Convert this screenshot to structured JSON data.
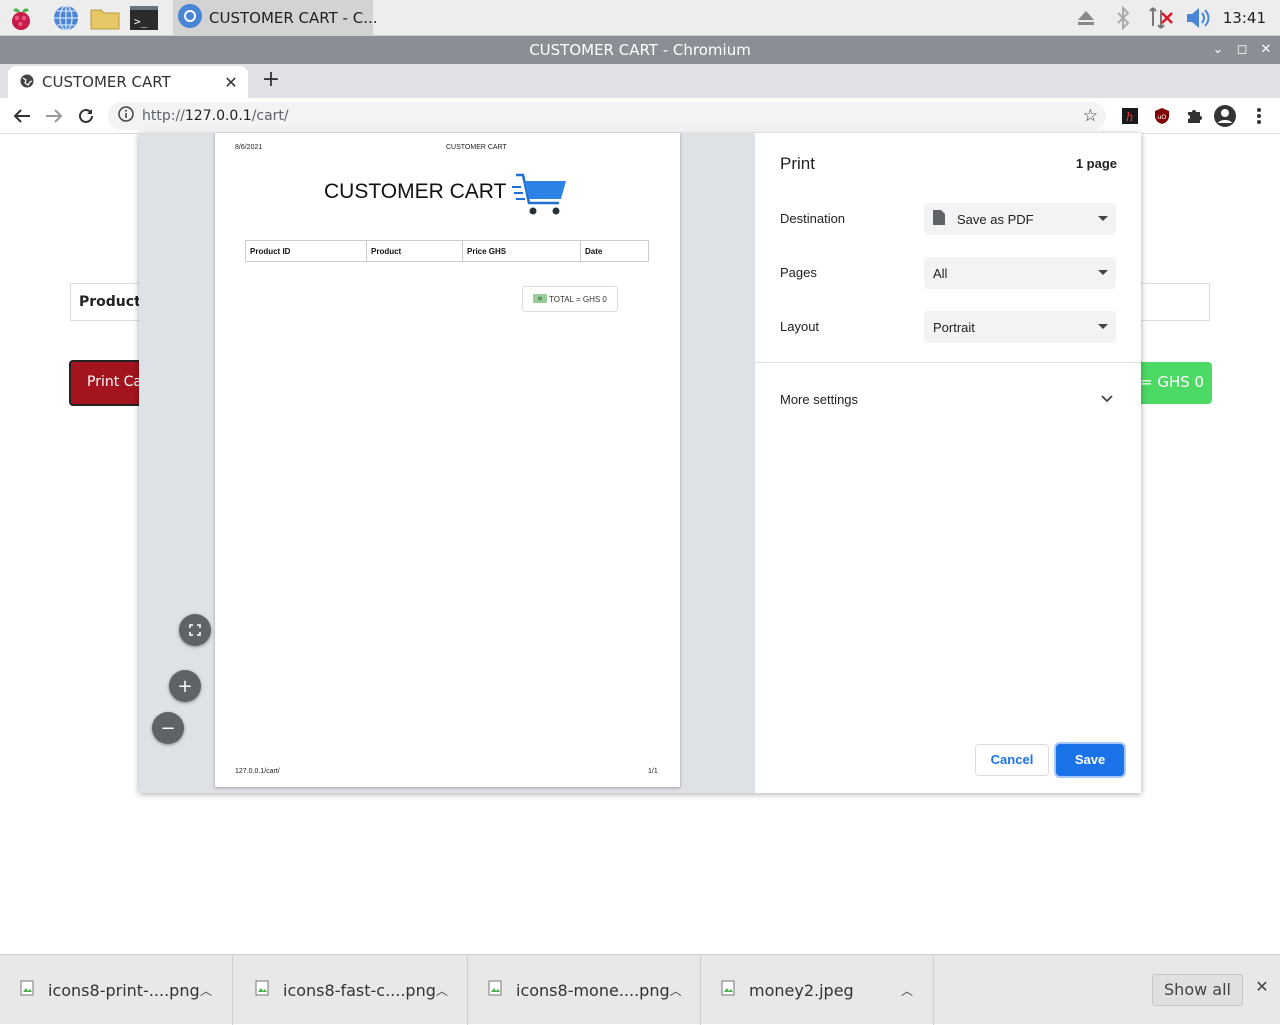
{
  "taskbar": {
    "task_label": "CUSTOMER CART - C...",
    "clock": "13:41"
  },
  "window": {
    "title": "CUSTOMER CART - Chromium"
  },
  "tab": {
    "title": "CUSTOMER CART",
    "close": "✕",
    "new_tab": "+"
  },
  "toolbar": {
    "url_scheme": "http://",
    "url_host": "127.0.0.1",
    "url_path": "/cart/"
  },
  "page": {
    "table_head": "Product I",
    "print_button": "Print Car",
    "total": "= GHS 0"
  },
  "preview": {
    "date": "8/6/2021",
    "header_title": "CUSTOMER CART",
    "title": "CUSTOMER CART",
    "columns": [
      "Product ID",
      "Product",
      "Price GHS",
      "Date"
    ],
    "total": "TOTAL = GHS 0",
    "footer_url": "127.0.0.1/cart/",
    "footer_page": "1/1"
  },
  "print_settings": {
    "title": "Print",
    "page_count": "1 page",
    "destination_label": "Destination",
    "destination_value": "Save as PDF",
    "pages_label": "Pages",
    "pages_value": "All",
    "layout_label": "Layout",
    "layout_value": "Portrait",
    "more_settings": "More settings",
    "cancel": "Cancel",
    "save": "Save"
  },
  "downloads": {
    "items": [
      {
        "name": "icons8-print-....png"
      },
      {
        "name": "icons8-fast-c....png"
      },
      {
        "name": "icons8-mone....png"
      },
      {
        "name": "money2.jpeg"
      }
    ],
    "show_all": "Show all",
    "close": "✕"
  },
  "colors": {
    "accent": "#1a73e8",
    "print_button": "#a3141f",
    "total_badge": "#4cd964"
  }
}
